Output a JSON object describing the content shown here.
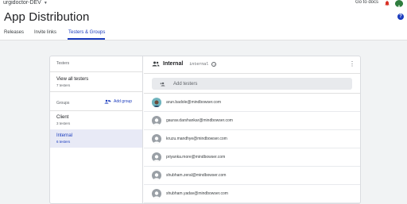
{
  "header": {
    "project_name": "urgidoctor-DEV",
    "title": "App Distribution",
    "goto_docs": "Go to docs"
  },
  "tabs": [
    "Releases",
    "Invite links",
    "Testers & Groups"
  ],
  "active_tab": 2,
  "left_panel": {
    "testers_heading": "Testers",
    "view_all": {
      "label": "View all testers",
      "count": "7 testers"
    },
    "groups_heading": "Groups",
    "add_group_label": "Add group",
    "groups": [
      {
        "name": "Client",
        "count": "3 testers",
        "selected": false
      },
      {
        "name": "Internal",
        "count": "6 testers",
        "selected": true
      }
    ]
  },
  "right_panel": {
    "group_name": "Internal",
    "group_alias": "internal",
    "add_testers_label": "Add testers",
    "testers": [
      {
        "email": "arun.badole@mindbowser.com",
        "has_photo": true
      },
      {
        "email": "gaurav.darshankar@mindbowser.com",
        "has_photo": false
      },
      {
        "email": "kruzu.mandhye@mindbowser.com",
        "has_photo": false
      },
      {
        "email": "priyanka.more@mindbowser.com",
        "has_photo": false
      },
      {
        "email": "shubham.zeral@mindbowser.com",
        "has_photo": false
      },
      {
        "email": "shubham.yadav@mindbowser.com",
        "has_photo": false
      }
    ]
  },
  "colors": {
    "accent": "#1a3bbd",
    "selected_bg": "#e8eaf6",
    "page_bg": "#f1f3f4"
  }
}
